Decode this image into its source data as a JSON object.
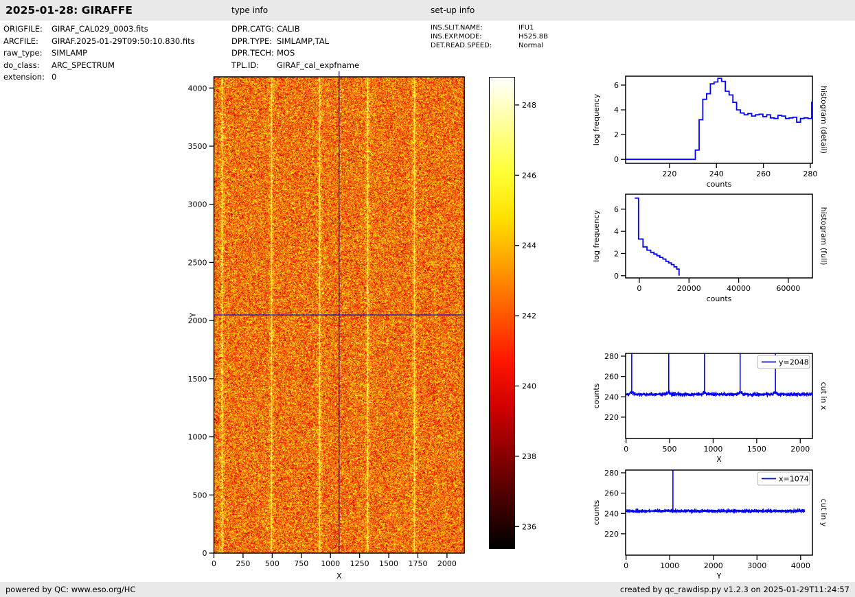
{
  "header": {
    "title": "2025-01-28: GIRAFFE",
    "type_info_label": "type info",
    "setup_info_label": "set-up info"
  },
  "metadata": {
    "file_info": [
      {
        "key": "ORIGFILE:",
        "value": "GIRAF_CAL029_0003.fits"
      },
      {
        "key": "ARCFILE:",
        "value": "GIRAF.2025-01-29T09:50:10.830.fits"
      },
      {
        "key": "raw_type:",
        "value": "SIMLAMP"
      },
      {
        "key": "do_class:",
        "value": "ARC_SPECTRUM"
      },
      {
        "key": "extension:",
        "value": "0"
      }
    ],
    "type_info": [
      {
        "key": "DPR.CATG:",
        "value": "CALIB"
      },
      {
        "key": "DPR.TYPE:",
        "value": "SIMLAMP,TAL"
      },
      {
        "key": "DPR.TECH:",
        "value": "MOS"
      },
      {
        "key": "TPL.ID:",
        "value": "GIRAF_cal_expfname"
      }
    ],
    "setup_info": [
      {
        "key": "INS.SLIT.NAME:",
        "value": "IFU1"
      },
      {
        "key": "INS.EXP.MODE:",
        "value": "H525.8B"
      },
      {
        "key": "DET.READ.SPEED:",
        "value": "Normal"
      }
    ]
  },
  "footer": {
    "left": "powered by QC: www.eso.org/HC",
    "right": "created by qc_rawdisp.py v1.2.3 on 2025-01-29T11:24:57"
  },
  "colors": {
    "line_blue": "#0000ff",
    "crosshair_blue": "#1111cc",
    "bar_gray": "#e9e9e9",
    "legend_border": "#b3b3b3",
    "frame": "#000000"
  },
  "chart_data": [
    {
      "id": "detector_image",
      "type": "heatmap",
      "xlabel": "X",
      "ylabel": "Y",
      "xlim": [
        0,
        2148
      ],
      "ylim": [
        0,
        4096
      ],
      "xticks": [
        0,
        250,
        500,
        750,
        1000,
        1250,
        1500,
        1750,
        2000
      ],
      "yticks": [
        0,
        500,
        1000,
        1500,
        2000,
        2500,
        3000,
        3500,
        4000
      ],
      "colormap": "hot",
      "colorbar": {
        "ticks": [
          236,
          238,
          240,
          242,
          244,
          246,
          248
        ],
        "vmin": 235.4,
        "vmax": 248.8
      },
      "background": {
        "mean_counts": 242.6,
        "sigma_counts": 1.9
      },
      "bright_columns_x": [
        65,
        490,
        900,
        1310,
        1715
      ],
      "crosshair": {
        "x": 1074,
        "y": 2048
      }
    },
    {
      "id": "histogram_detail",
      "type": "step",
      "right_label": "histogram (detail)",
      "xlabel": "counts",
      "ylabel": "log frequency",
      "xlim": [
        201.3,
        280.9
      ],
      "ylim": [
        -0.32,
        6.72
      ],
      "xticks": [
        220,
        240,
        260,
        280
      ],
      "yticks": [
        0,
        2,
        4,
        6
      ],
      "edges": [
        201.3,
        231,
        232.6,
        234.2,
        235.8,
        237.4,
        239.0,
        240.6,
        242.2,
        243.8,
        245.4,
        247.0,
        248.6,
        250.2,
        251.8,
        253.4,
        255.0,
        256.6,
        258.2,
        259.8,
        261.4,
        263.0,
        264.6,
        266.2,
        267.8,
        269.4,
        271.0,
        272.6,
        274.2,
        275.8,
        277.4,
        279.0,
        280.6,
        281.5
      ],
      "heights": [
        0,
        0.75,
        3.2,
        4.85,
        5.3,
        6.1,
        6.25,
        6.55,
        6.3,
        5.5,
        5.2,
        4.6,
        4.0,
        3.75,
        3.6,
        3.7,
        3.5,
        3.6,
        3.65,
        3.45,
        3.6,
        3.35,
        3.3,
        3.55,
        3.5,
        3.3,
        3.35,
        3.4,
        3.0,
        3.3,
        3.35,
        3.3,
        4.6
      ],
      "close_to_zero": false
    },
    {
      "id": "histogram_full",
      "type": "step",
      "right_label": "histogram (full)",
      "xlabel": "counts",
      "ylabel": "log frequency",
      "xlim": [
        -5500,
        69700
      ],
      "ylim": [
        -0.2,
        7.35
      ],
      "xticks": [
        0,
        20000,
        40000,
        60000
      ],
      "yticks": [
        0,
        2,
        4,
        6
      ],
      "edges": [
        -1800,
        -300,
        1500,
        3100,
        4600,
        5900,
        7100,
        8300,
        9500,
        10700,
        11800,
        12900,
        14000,
        15100,
        16000
      ],
      "heights": [
        7.0,
        3.3,
        2.6,
        2.3,
        2.1,
        1.95,
        1.8,
        1.65,
        1.5,
        1.3,
        1.15,
        1.0,
        0.8,
        0.6
      ],
      "close_to_zero": true
    },
    {
      "id": "cut_in_x",
      "type": "noise_line",
      "right_label": "cut in x",
      "xlabel": "X",
      "ylabel": "counts",
      "legend": "y=2048",
      "xlim": [
        -5,
        2140
      ],
      "ylim": [
        199,
        282.7
      ],
      "xticks": [
        0,
        500,
        1000,
        1500,
        2000
      ],
      "yticks": [
        220,
        240,
        260,
        280
      ],
      "baseline_counts": 242.4,
      "noise_halfwidth_counts": 2.2,
      "spikes_x": [
        65,
        490,
        900,
        1310,
        1715
      ],
      "spike_top_counts": 282.7
    },
    {
      "id": "cut_in_y",
      "type": "noise_line",
      "right_label": "cut in y",
      "xlabel": "Y",
      "ylabel": "counts",
      "legend": "x=1074",
      "xlim": [
        -10,
        4270
      ],
      "ylim": [
        199,
        282.7
      ],
      "xticks": [
        0,
        1000,
        2000,
        3000,
        4000
      ],
      "yticks": [
        220,
        240,
        260,
        280
      ],
      "baseline_counts": 242.4,
      "noise_halfwidth_counts": 2.2,
      "spikes_x": [
        1074
      ],
      "spike_top_counts": 282.7
    }
  ]
}
